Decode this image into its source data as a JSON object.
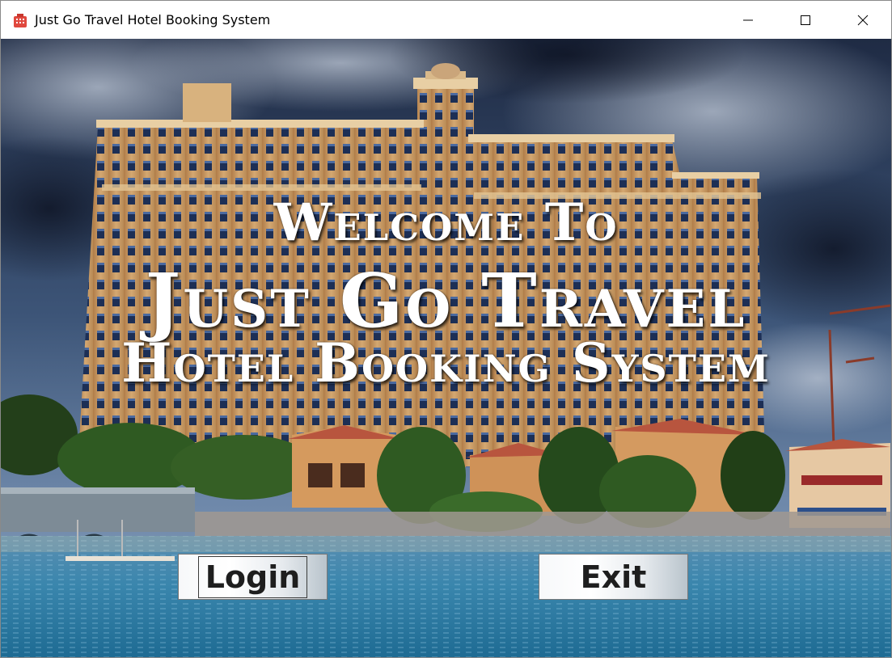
{
  "window": {
    "title": "Just Go Travel Hotel Booking System",
    "icon": "hotel-building-icon"
  },
  "caption": {
    "minimize_icon": "minimize-icon",
    "maximize_icon": "maximize-icon",
    "close_icon": "close-icon"
  },
  "welcome": {
    "line1": "Welcome To",
    "line2": "Just Go Travel",
    "line3": "Hotel Booking System"
  },
  "buttons": {
    "login_label": "Login",
    "exit_label": "Exit"
  },
  "colors": {
    "sky": "#2c3e5a",
    "building": "#c89a62",
    "water": "#2a7fa8",
    "roof": "#b8553e",
    "trees": "#2f5a22"
  }
}
